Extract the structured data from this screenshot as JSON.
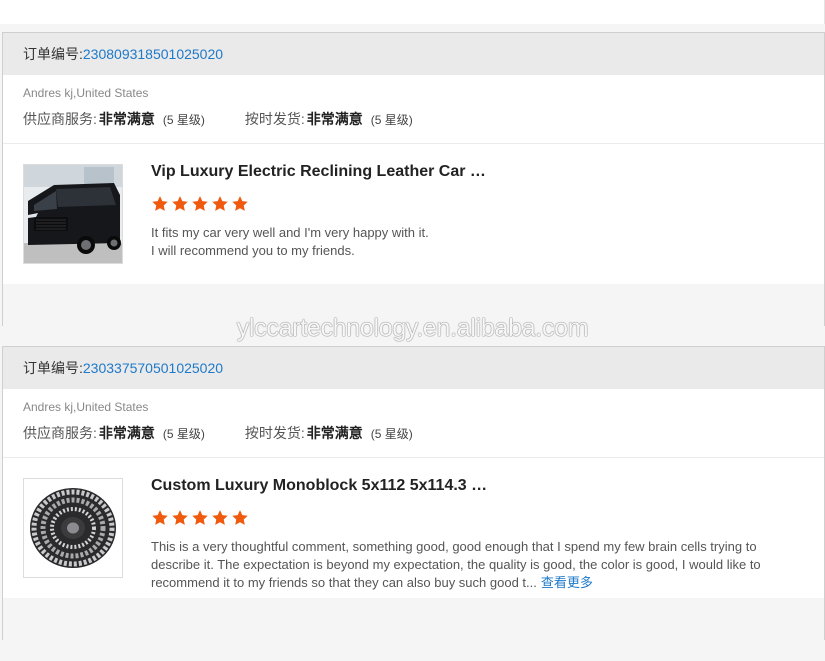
{
  "reviews": [
    {
      "order_label": "订单编号:",
      "order_number": "230809318501025020",
      "buyer": "Andres kj,United States",
      "supplier_service_label": "供应商服务:",
      "supplier_service_value": "非常满意",
      "supplier_service_grade": "(5 星级)",
      "shipping_label": "按时发货:",
      "shipping_value": "非常满意",
      "shipping_grade": "(5 星级)",
      "product_title": "Vip Luxury Electric Reclining Leather Car Seat ...",
      "stars": 5,
      "review_text_line1": "It fits my car very well and I'm very happy with it.",
      "review_text_line2": "I will recommend you to my friends.",
      "thumbnail_icon": "van-photo-icon"
    },
    {
      "order_label": "订单编号:",
      "order_number": "230337570501025020",
      "buyer": "Andres kj,United States",
      "supplier_service_label": "供应商服务:",
      "supplier_service_value": "非常满意",
      "supplier_service_grade": "(5 星级)",
      "shipping_label": "按时发货:",
      "shipping_value": "非常满意",
      "shipping_grade": "(5 星级)",
      "product_title": "Custom Luxury Monoblock 5x112 5x114.3 5x1...",
      "stars": 5,
      "review_text": "This is a very thoughtful comment, something good, good enough that I spend my few brain cells trying to describe it. The expectation is beyond my expectation, the quality is good, the color is good, I would like to recommend it to my friends so that they can also buy such good t...",
      "more_link": "查看更多",
      "thumbnail_icon": "wheel-photo-icon"
    }
  ],
  "watermark": "ylccartechnology.en.alibaba.com",
  "colors": {
    "star": "#f05a0e",
    "link": "#1e79c9",
    "header_bg": "#eaeaea"
  }
}
